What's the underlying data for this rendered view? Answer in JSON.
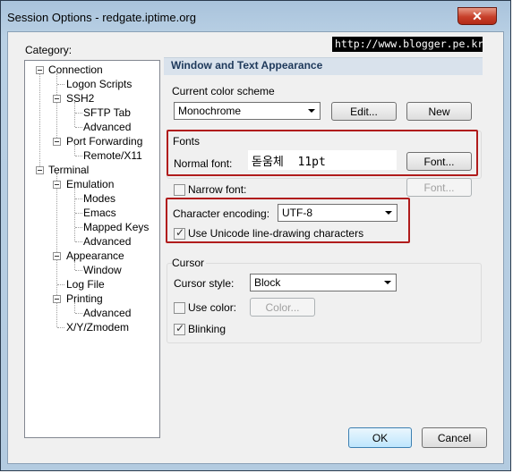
{
  "window": {
    "title": "Session Options - redgate.iptime.org",
    "close_glyph": "✕"
  },
  "watermark": "http://www.blogger.pe.kr",
  "category_label": "Category:",
  "tree": {
    "connection": "Connection",
    "logon_scripts": "Logon Scripts",
    "ssh2": "SSH2",
    "sftp_tab": "SFTP Tab",
    "ssh2_advanced": "Advanced",
    "port_forwarding": "Port Forwarding",
    "remote_x11": "Remote/X11",
    "terminal": "Terminal",
    "emulation": "Emulation",
    "modes": "Modes",
    "emacs": "Emacs",
    "mapped_keys": "Mapped Keys",
    "emulation_advanced": "Advanced",
    "appearance": "Appearance",
    "window": "Window",
    "log_file": "Log File",
    "printing": "Printing",
    "printing_advanced": "Advanced",
    "xyz_modem": "X/Y/Zmodem"
  },
  "panel": {
    "title": "Window and Text Appearance",
    "color_scheme": {
      "label": "Current color scheme",
      "value": "Monochrome",
      "edit_button": "Edit...",
      "new_button": "New"
    },
    "fonts": {
      "group_label": "Fonts",
      "normal_font_label": "Normal font:",
      "normal_font_value": "돋움체  11pt",
      "font_button": "Font...",
      "narrow_font_label": "Narrow font:",
      "narrow_font_button": "Font..."
    },
    "encoding": {
      "label": "Character encoding:",
      "value": "UTF-8",
      "unicode_line_drawing": "Use Unicode line-drawing characters"
    },
    "cursor": {
      "group_label": "Cursor",
      "style_label": "Cursor style:",
      "style_value": "Block",
      "use_color_label": "Use color:",
      "color_button": "Color...",
      "blinking_label": "Blinking"
    }
  },
  "footer": {
    "ok": "OK",
    "cancel": "Cancel"
  }
}
